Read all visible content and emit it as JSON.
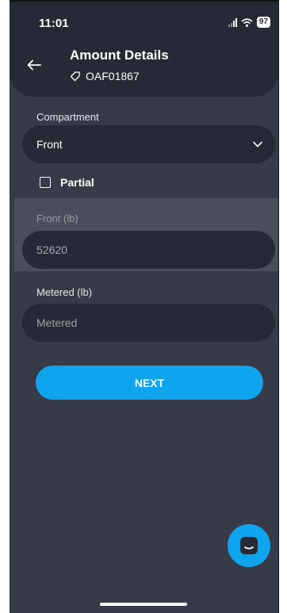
{
  "status_bar": {
    "time": "11:01",
    "battery": "97"
  },
  "header": {
    "title": "Amount Details",
    "order_id": "OAF01867"
  },
  "form": {
    "compartment_label": "Compartment",
    "compartment_value": "Front",
    "partial_label": "Partial",
    "partial_checked": false,
    "front_label": "Front (lb)",
    "front_value": "52620",
    "metered_label": "Metered (lb)",
    "metered_placeholder": "Metered",
    "next_label": "NEXT"
  },
  "colors": {
    "background": "#373b49",
    "surface": "#262a36",
    "accent": "#0ea5ee"
  },
  "icons": {
    "back": "arrow-left-icon",
    "tag": "tag-icon",
    "dropdown": "chevron-down-icon",
    "chat": "chat-bubble-icon"
  }
}
